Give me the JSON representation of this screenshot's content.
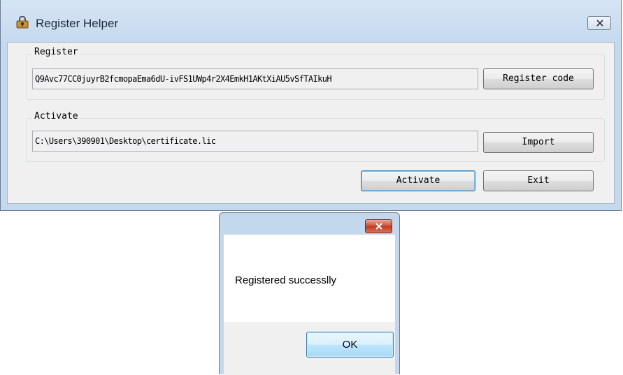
{
  "main_window": {
    "title": "Register Helper",
    "icon": "app-lock-icon",
    "register_group": {
      "legend": "Register",
      "code_value": "Q9Avc77CC0juyrB2fcmopaEma6dU-ivFS1UWp4r2X4EmkH1AKtXiAU5vSfTAIkuH",
      "register_code_button": "Register code"
    },
    "activate_group": {
      "legend": "Activate",
      "path_value": "C:\\Users\\390901\\Desktop\\certificate.lic",
      "import_button": "Import"
    },
    "activate_button": "Activate",
    "exit_button": "Exit"
  },
  "message_box": {
    "text": "Registered successlly",
    "ok_button": "OK"
  },
  "colors": {
    "title_bar": "#c6d9ee",
    "client_bg": "#f0f0f0",
    "close_red": "#c74a38",
    "default_button_border": "#3c7fb1"
  }
}
